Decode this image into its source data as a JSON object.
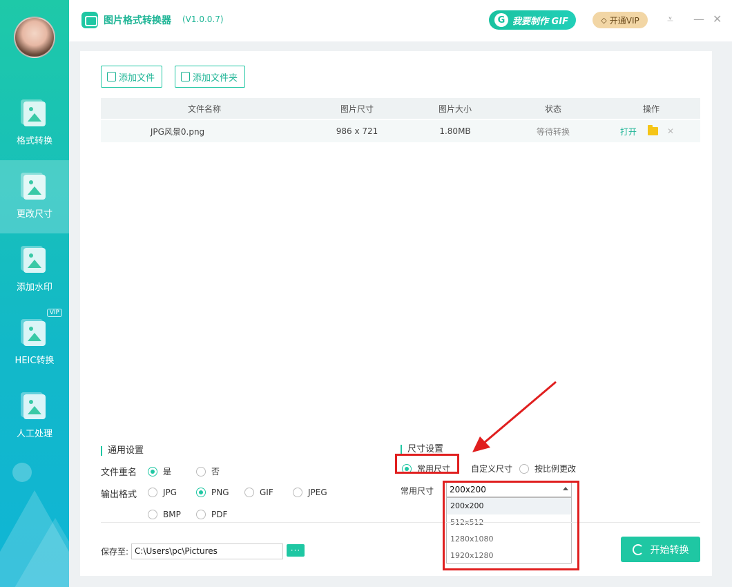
{
  "app": {
    "title": "图片格式转换器",
    "version": "(V1.0.0.7)"
  },
  "header": {
    "gif_button": "我要制作 GIF",
    "vip_button": "开通VIP"
  },
  "sidebar": {
    "items": [
      {
        "label": "格式转换"
      },
      {
        "label": "更改尺寸",
        "active": true
      },
      {
        "label": "添加水印"
      },
      {
        "label": "HEIC转换",
        "badge": "VIP"
      },
      {
        "label": "人工处理"
      }
    ]
  },
  "toolbar": {
    "add_file": "添加文件",
    "add_folder": "添加文件夹"
  },
  "table": {
    "columns": [
      "文件名称",
      "图片尺寸",
      "图片大小",
      "状态",
      "操作"
    ],
    "rows": [
      {
        "name": "JPG风景0.png",
        "dimensions": "986 x 721",
        "size": "1.80MB",
        "status": "等待转换",
        "action_open": "打开"
      }
    ]
  },
  "general": {
    "title": "通用设置",
    "rename_label": "文件重名",
    "rename_options": [
      "是",
      "否"
    ],
    "rename_selected": "是",
    "format_label": "输出格式",
    "format_options": [
      "JPG",
      "PNG",
      "GIF",
      "JPEG",
      "BMP",
      "PDF"
    ],
    "format_selected": "PNG"
  },
  "size": {
    "title": "尺寸设置",
    "mode_options": [
      "常用尺寸",
      "自定义尺寸",
      "按比例更改"
    ],
    "mode_selected": "常用尺寸",
    "common_label": "常用尺寸",
    "selected_value": "200x200",
    "dropdown_options": [
      "200x200",
      "512x512",
      "1280x1080",
      "1920x1280"
    ]
  },
  "footer": {
    "save_label": "保存至:",
    "save_path": "C:\\Users\\pc\\Pictures",
    "browse": "···",
    "start_button": "开始转换"
  },
  "colors": {
    "accent": "#1fc7a3",
    "annotation": "#e01f1f"
  }
}
